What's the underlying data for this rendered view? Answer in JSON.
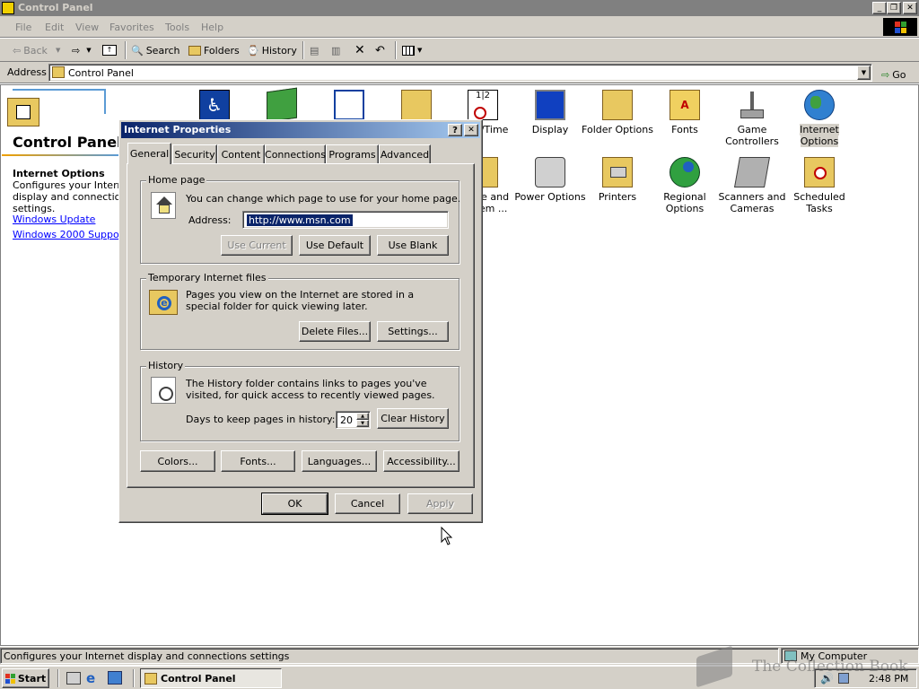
{
  "window": {
    "title": "Control Panel"
  },
  "menu": {
    "items": [
      "File",
      "Edit",
      "View",
      "Favorites",
      "Tools",
      "Help"
    ]
  },
  "toolbar": {
    "back": "Back",
    "search": "Search",
    "folders": "Folders",
    "history": "History"
  },
  "address": {
    "label": "Address",
    "value": "Control Panel",
    "go": "Go"
  },
  "left_panel": {
    "title": "Control Panel",
    "selected_title": "Internet Options",
    "selected_desc": "Configures your Internet display and connections settings.",
    "links": [
      "Windows Update",
      "Windows 2000 Support"
    ]
  },
  "items": [
    {
      "label": "Date/Time"
    },
    {
      "label": "Display"
    },
    {
      "label": "Folder Options"
    },
    {
      "label": "Fonts"
    },
    {
      "label": "Game Controllers"
    },
    {
      "label": "Internet Options"
    },
    {
      "label": "Phone and Modem ..."
    },
    {
      "label": "Power Options"
    },
    {
      "label": "Printers"
    },
    {
      "label": "Regional Options"
    },
    {
      "label": "Scanners and Cameras"
    },
    {
      "label": "Scheduled Tasks"
    }
  ],
  "dialog": {
    "title": "Internet Properties",
    "help": "?",
    "close": "✕",
    "tabs": [
      "General",
      "Security",
      "Content",
      "Connections",
      "Programs",
      "Advanced"
    ],
    "home": {
      "legend": "Home page",
      "desc": "You can change which page to use for your home page.",
      "address_label": "Address:",
      "address_value": "http://www.msn.com",
      "use_current": "Use Current",
      "use_default": "Use Default",
      "use_blank": "Use Blank"
    },
    "temp": {
      "legend": "Temporary Internet files",
      "desc": "Pages you view on the Internet are stored in a special folder for quick viewing later.",
      "delete": "Delete Files...",
      "settings": "Settings..."
    },
    "history": {
      "legend": "History",
      "desc": "The History folder contains links to pages you've visited, for quick access to recently viewed pages.",
      "days_label": "Days to keep pages in history:",
      "days": "20",
      "clear": "Clear History"
    },
    "bottom": {
      "colors": "Colors...",
      "fonts": "Fonts...",
      "languages": "Languages...",
      "accessibility": "Accessibility..."
    },
    "ok": "OK",
    "cancel": "Cancel",
    "apply": "Apply"
  },
  "status": {
    "text": "Configures your Internet display and connections settings",
    "zone": "My Computer"
  },
  "taskbar": {
    "start": "Start",
    "task": "Control Panel",
    "clock": "2:48 PM"
  },
  "watermark": "The Collection Book"
}
